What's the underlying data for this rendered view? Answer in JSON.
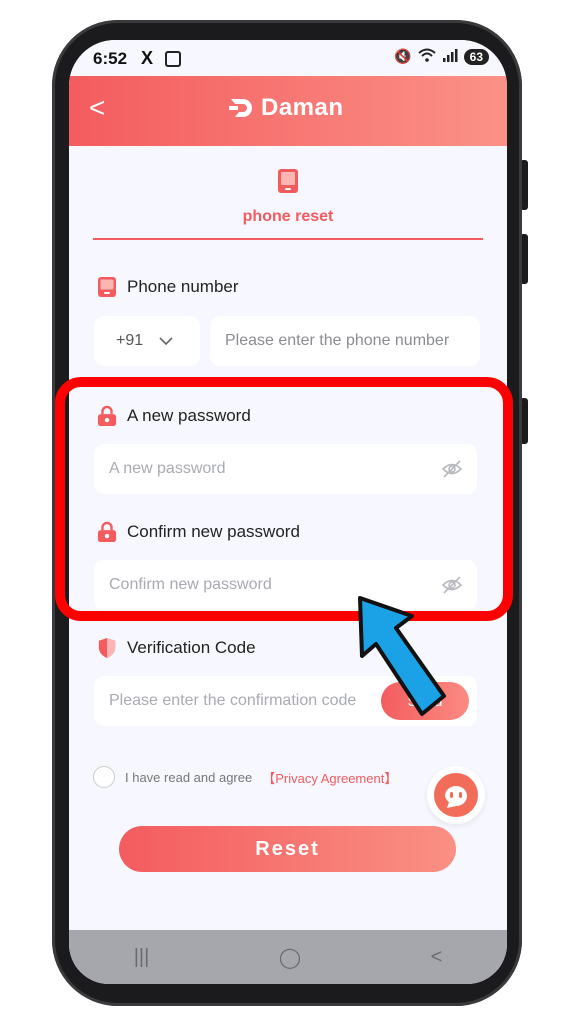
{
  "status_bar": {
    "time": "6:52",
    "x_icon": "X",
    "battery": "63"
  },
  "header": {
    "back": "<",
    "brand": "Daman"
  },
  "tab": {
    "label": "phone reset"
  },
  "phone": {
    "label": "Phone number",
    "country_code": "+91",
    "placeholder": "Please enter the phone number"
  },
  "new_password": {
    "label": "A new password",
    "placeholder": "A new password"
  },
  "confirm_password": {
    "label": "Confirm new password",
    "placeholder": "Confirm new password"
  },
  "verification": {
    "label": "Verification Code",
    "placeholder": "Please enter the confirmation code",
    "send_label": "Send"
  },
  "agreement": {
    "text": "I have read and agree",
    "link": "【Privacy Agreement】"
  },
  "reset_button": "Reset",
  "nav": {
    "recent": "|||",
    "home": "◯",
    "back": "<"
  },
  "colors": {
    "accent": "#f35b5e",
    "highlight": "#ff0000",
    "arrow": "#1aa1e6"
  }
}
